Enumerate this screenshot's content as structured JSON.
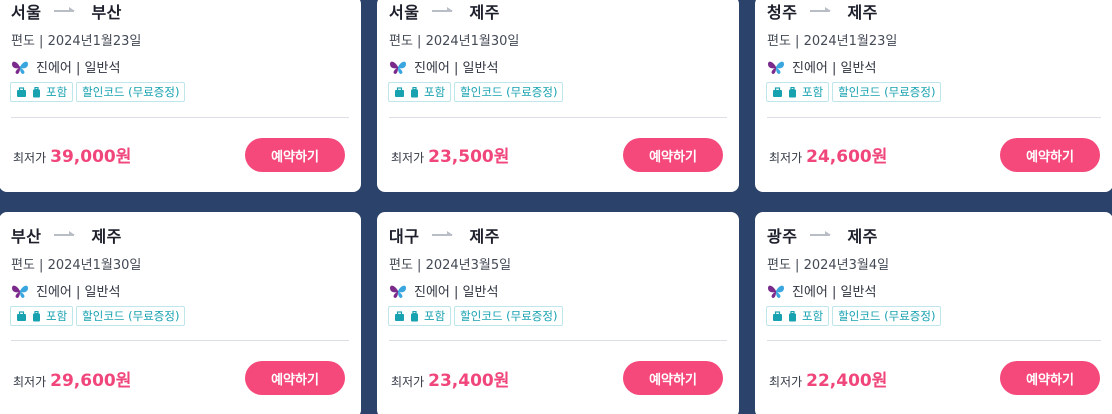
{
  "colors": {
    "page_background": "#2b426b",
    "card_background": "#ffffff",
    "price": "#f0467b",
    "button": "#f5497c",
    "tag_text": "#18a2b0",
    "tag_border": "#bfe6ea"
  },
  "labels": {
    "price_prefix": "최저가",
    "book_button": "예약하기",
    "baggage_tag": "포함",
    "discount_tag": "할인코드 (무료증정)"
  },
  "icons": {
    "route_arrow": "arrow-right-icon",
    "airline_logo": "jin-air-butterfly-logo",
    "baggage": "bag-icon",
    "luggage": "luggage-icon"
  },
  "cards": [
    {
      "from": "서울",
      "to": "부산",
      "trip": "편도 | 2024년1월23일",
      "airline": "진에어 | 일반석",
      "price": "39,000원"
    },
    {
      "from": "서울",
      "to": "제주",
      "trip": "편도 | 2024년1월30일",
      "airline": "진에어 | 일반석",
      "price": "23,500원"
    },
    {
      "from": "청주",
      "to": "제주",
      "trip": "편도 | 2024년1월23일",
      "airline": "진에어 | 일반석",
      "price": "24,600원"
    },
    {
      "from": "부산",
      "to": "제주",
      "trip": "편도 | 2024년1월30일",
      "airline": "진에어 | 일반석",
      "price": "29,600원"
    },
    {
      "from": "대구",
      "to": "제주",
      "trip": "편도 | 2024년3월5일",
      "airline": "진에어 | 일반석",
      "price": "23,400원"
    },
    {
      "from": "광주",
      "to": "제주",
      "trip": "편도 | 2024년3월4일",
      "airline": "진에어 | 일반석",
      "price": "22,400원"
    }
  ]
}
